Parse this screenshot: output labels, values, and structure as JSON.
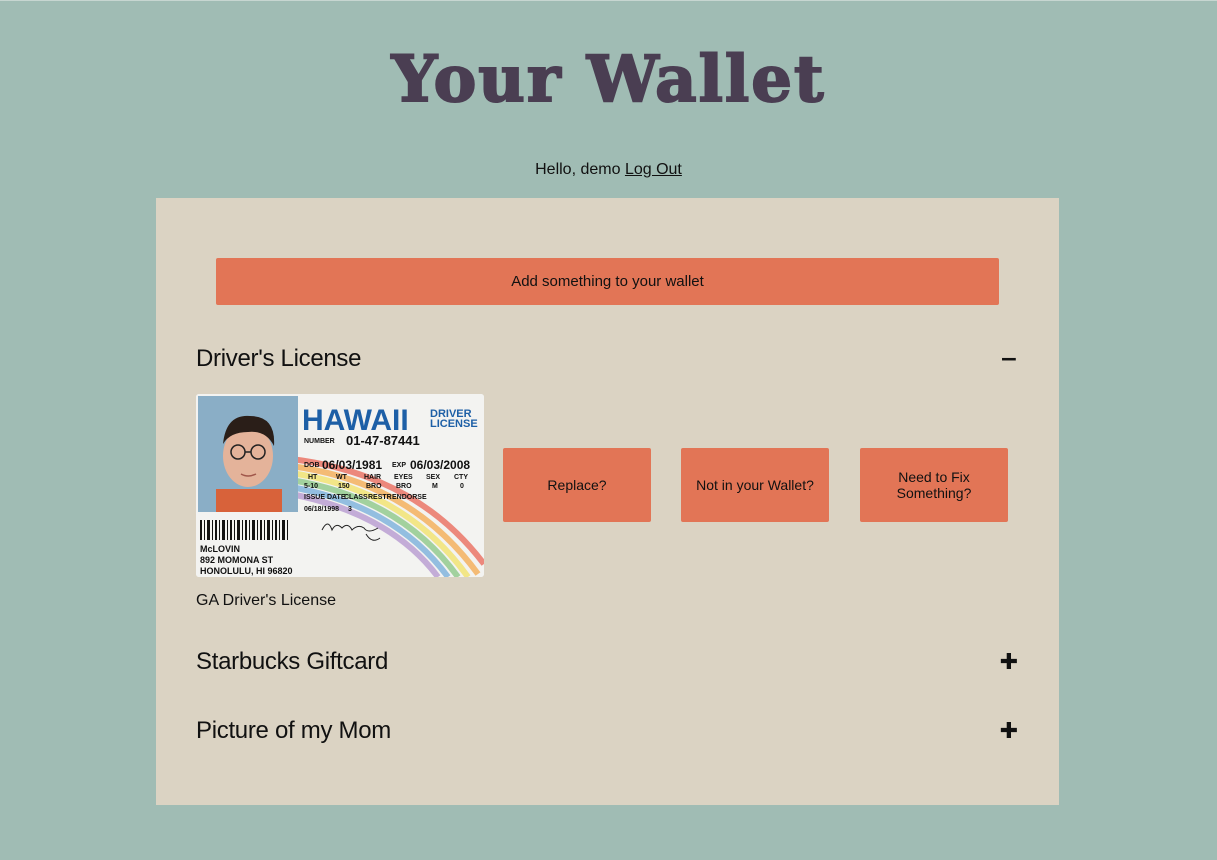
{
  "app": {
    "title": "Your Wallet",
    "greeting_prefix": "Hello, demo",
    "logout_label": "Log Out"
  },
  "panel": {
    "add_label": "Add something to your wallet",
    "sections": [
      {
        "title": "Driver's License",
        "toggle": "−",
        "expanded": true,
        "caption": "GA Driver's License",
        "actions": [
          "Replace?",
          "Not in your Wallet?",
          "Need to Fix Something?"
        ]
      },
      {
        "title": "Starbucks Giftcard",
        "toggle": "✚",
        "expanded": false
      },
      {
        "title": "Picture of my Mom",
        "toggle": "✚",
        "expanded": false
      }
    ]
  },
  "license_card": {
    "state": "HAWAII",
    "type_line1": "DRIVER",
    "type_line2": "LICENSE",
    "number_label": "NUMBER",
    "number": "01-47-87441",
    "dob_label": "DOB",
    "dob": "06/03/1981",
    "exp_label": "EXP",
    "exp": "06/03/2008",
    "field_labels": [
      "HT",
      "WT",
      "HAIR",
      "EYES",
      "SEX",
      "CTY"
    ],
    "field_values": [
      "5-10",
      "150",
      "BRO",
      "BRO",
      "M",
      "0"
    ],
    "issue_labels": [
      "ISSUE DATE",
      "CLASS",
      "RESTR",
      "ENDORSE"
    ],
    "issue_values": [
      "06/18/1998",
      "3"
    ],
    "signature": "McLovin",
    "name": "McLOVIN",
    "address1": "892 MOMONA ST",
    "address2": "HONOLULU, HI 96820"
  },
  "colors": {
    "background": "#a0bcb4",
    "panel": "#dbd3c3",
    "accent": "#e27556",
    "title": "#4a3e52"
  }
}
